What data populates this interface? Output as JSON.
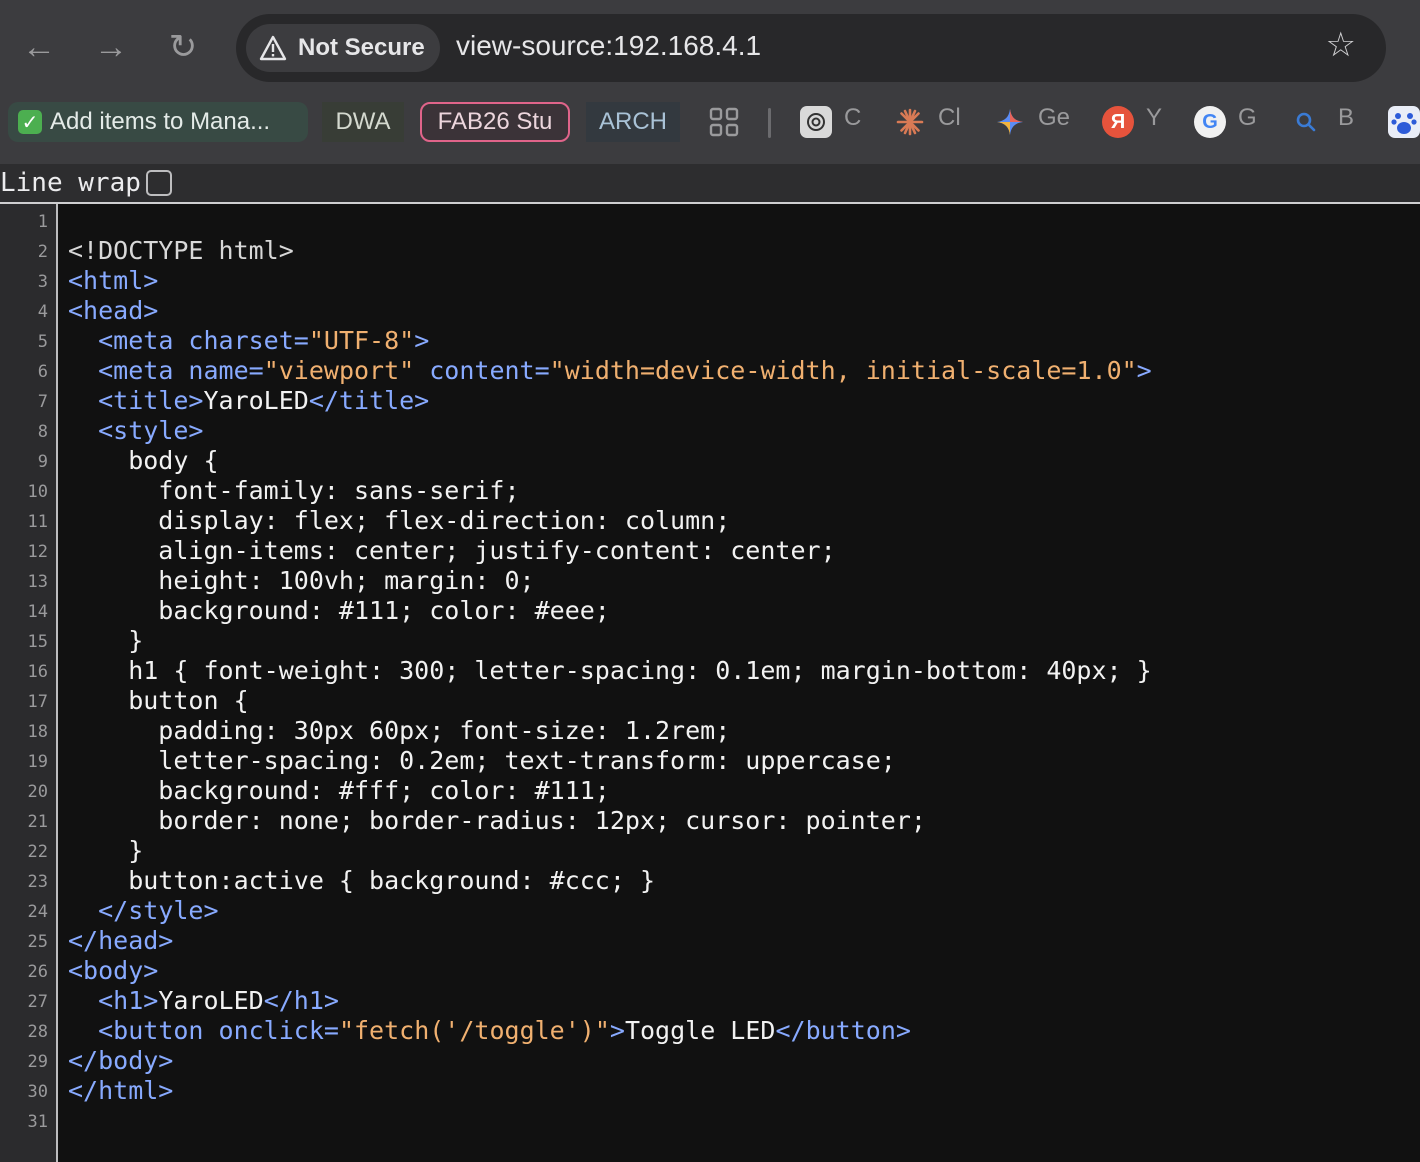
{
  "toolbar": {
    "back_icon": "arrow-left-icon",
    "forward_icon": "arrow-right-icon",
    "reload_icon": "reload-icon",
    "security_label": "Not Secure",
    "url": "view-source:192.168.4.1",
    "bookmark_star_icon": "star-icon"
  },
  "bookmarks": {
    "items": [
      {
        "label": "Add items to Mana...",
        "icon": "green-check-icon"
      },
      {
        "label": "DWA"
      },
      {
        "label": "FAB26 Stu"
      },
      {
        "label": "ARCH"
      }
    ],
    "apps_icon": "apps-grid-icon",
    "favicons": [
      {
        "label": "C",
        "icon": "chatgpt-icon"
      },
      {
        "label": "Cl",
        "icon": "claude-icon"
      },
      {
        "label": "Ge",
        "icon": "gemini-icon"
      },
      {
        "label": "Y",
        "icon": "yandex-icon",
        "glyph": "Я"
      },
      {
        "label": "G",
        "icon": "google-icon",
        "glyph": "G"
      },
      {
        "label": "B",
        "icon": "search-icon"
      },
      {
        "label": "",
        "icon": "baidu-icon"
      }
    ],
    "colors": {
      "green": "#4caf50",
      "fab_border": "#e0648a"
    }
  },
  "source_view": {
    "line_wrap_label": "Line wrap",
    "line_wrap_checked": false,
    "lines": [
      {
        "n": "1",
        "tokens": []
      },
      {
        "n": "2",
        "tokens": [
          {
            "t": "doc",
            "v": "<!DOCTYPE html>"
          }
        ]
      },
      {
        "n": "3",
        "tokens": [
          {
            "t": "tag",
            "v": "<html>"
          }
        ]
      },
      {
        "n": "4",
        "tokens": [
          {
            "t": "tag",
            "v": "<head>"
          }
        ]
      },
      {
        "n": "5",
        "tokens": [
          {
            "t": "text",
            "v": "  "
          },
          {
            "t": "tag",
            "v": "<meta "
          },
          {
            "t": "attr",
            "v": "charset="
          },
          {
            "t": "val",
            "v": "\"UTF-8\""
          },
          {
            "t": "tag",
            "v": ">"
          }
        ]
      },
      {
        "n": "6",
        "tokens": [
          {
            "t": "text",
            "v": "  "
          },
          {
            "t": "tag",
            "v": "<meta "
          },
          {
            "t": "attr",
            "v": "name="
          },
          {
            "t": "val",
            "v": "\"viewport\""
          },
          {
            "t": "attr",
            "v": " content="
          },
          {
            "t": "val",
            "v": "\"width=device-width, initial-scale=1.0\""
          },
          {
            "t": "tag",
            "v": ">"
          }
        ]
      },
      {
        "n": "7",
        "tokens": [
          {
            "t": "text",
            "v": "  "
          },
          {
            "t": "tag",
            "v": "<title>"
          },
          {
            "t": "text",
            "v": "YaroLED"
          },
          {
            "t": "tag",
            "v": "</title>"
          }
        ]
      },
      {
        "n": "8",
        "tokens": [
          {
            "t": "text",
            "v": "  "
          },
          {
            "t": "tag",
            "v": "<style>"
          }
        ]
      },
      {
        "n": "9",
        "tokens": [
          {
            "t": "text",
            "v": "    body {"
          }
        ]
      },
      {
        "n": "10",
        "tokens": [
          {
            "t": "text",
            "v": "      font-family: sans-serif;"
          }
        ]
      },
      {
        "n": "11",
        "tokens": [
          {
            "t": "text",
            "v": "      display: flex; flex-direction: column;"
          }
        ]
      },
      {
        "n": "12",
        "tokens": [
          {
            "t": "text",
            "v": "      align-items: center; justify-content: center;"
          }
        ]
      },
      {
        "n": "13",
        "tokens": [
          {
            "t": "text",
            "v": "      height: 100vh; margin: 0;"
          }
        ]
      },
      {
        "n": "14",
        "tokens": [
          {
            "t": "text",
            "v": "      background: #111; color: #eee;"
          }
        ]
      },
      {
        "n": "15",
        "tokens": [
          {
            "t": "text",
            "v": "    }"
          }
        ]
      },
      {
        "n": "16",
        "tokens": [
          {
            "t": "text",
            "v": "    h1 { font-weight: 300; letter-spacing: 0.1em; margin-bottom: 40px; }"
          }
        ]
      },
      {
        "n": "17",
        "tokens": [
          {
            "t": "text",
            "v": "    button {"
          }
        ]
      },
      {
        "n": "18",
        "tokens": [
          {
            "t": "text",
            "v": "      padding: 30px 60px; font-size: 1.2rem;"
          }
        ]
      },
      {
        "n": "19",
        "tokens": [
          {
            "t": "text",
            "v": "      letter-spacing: 0.2em; text-transform: uppercase;"
          }
        ]
      },
      {
        "n": "20",
        "tokens": [
          {
            "t": "text",
            "v": "      background: #fff; color: #111;"
          }
        ]
      },
      {
        "n": "21",
        "tokens": [
          {
            "t": "text",
            "v": "      border: none; border-radius: 12px; cursor: pointer;"
          }
        ]
      },
      {
        "n": "22",
        "tokens": [
          {
            "t": "text",
            "v": "    }"
          }
        ]
      },
      {
        "n": "23",
        "tokens": [
          {
            "t": "text",
            "v": "    button:active { background: #ccc; }"
          }
        ]
      },
      {
        "n": "24",
        "tokens": [
          {
            "t": "text",
            "v": "  "
          },
          {
            "t": "tag",
            "v": "</style>"
          }
        ]
      },
      {
        "n": "25",
        "tokens": [
          {
            "t": "tag",
            "v": "</head>"
          }
        ]
      },
      {
        "n": "26",
        "tokens": [
          {
            "t": "tag",
            "v": "<body>"
          }
        ]
      },
      {
        "n": "27",
        "tokens": [
          {
            "t": "text",
            "v": "  "
          },
          {
            "t": "tag",
            "v": "<h1>"
          },
          {
            "t": "text",
            "v": "YaroLED"
          },
          {
            "t": "tag",
            "v": "</h1>"
          }
        ]
      },
      {
        "n": "28",
        "tokens": [
          {
            "t": "text",
            "v": "  "
          },
          {
            "t": "tag",
            "v": "<button "
          },
          {
            "t": "attr",
            "v": "onclick="
          },
          {
            "t": "val",
            "v": "\"fetch('/toggle')\""
          },
          {
            "t": "tag",
            "v": ">"
          },
          {
            "t": "text",
            "v": "Toggle LED"
          },
          {
            "t": "tag",
            "v": "</button>"
          }
        ]
      },
      {
        "n": "29",
        "tokens": [
          {
            "t": "tag",
            "v": "</body>"
          }
        ]
      },
      {
        "n": "30",
        "tokens": [
          {
            "t": "tag",
            "v": "</html>"
          }
        ]
      },
      {
        "n": "31",
        "tokens": []
      }
    ],
    "colors": {
      "tag": "#88aaff",
      "value": "#f0b070",
      "text": "#f2f2f2",
      "background": "#111111"
    }
  }
}
